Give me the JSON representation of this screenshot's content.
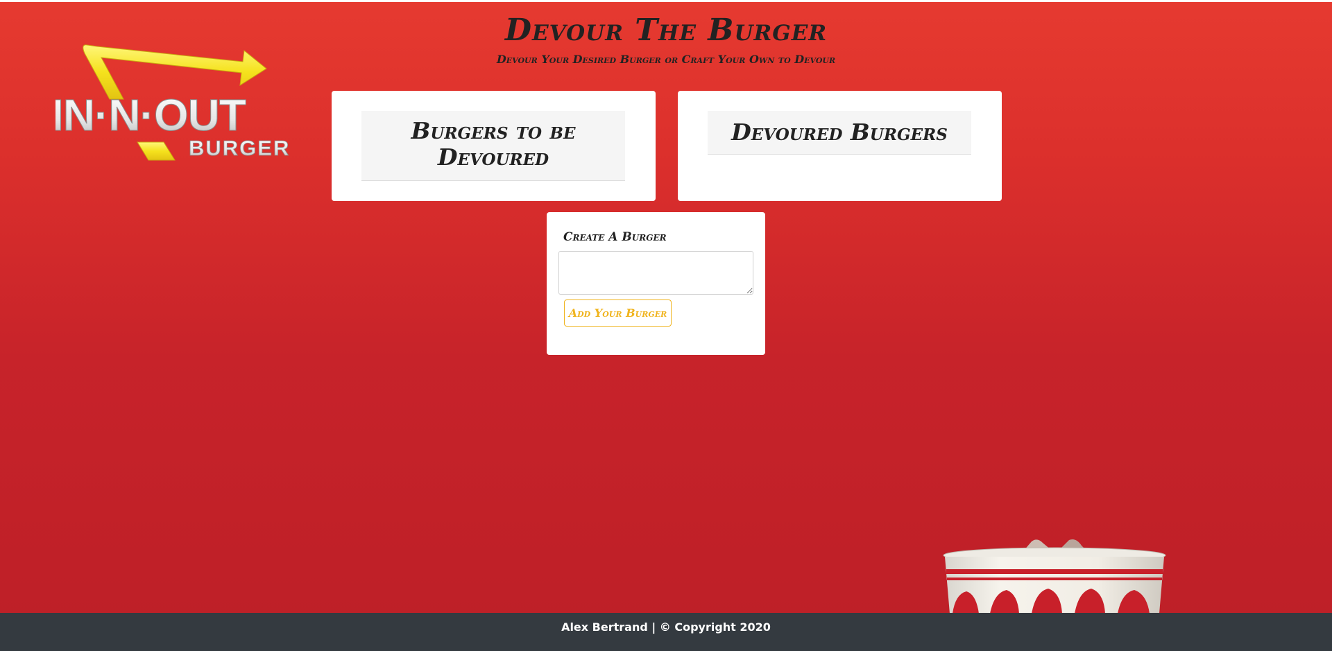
{
  "header": {
    "title": "Devour The Burger",
    "subtitle": "Devour Your Desired Burger or Craft Your Own to Devour"
  },
  "logo": {
    "line1": "IN·N·OUT",
    "line2": "BURGER"
  },
  "cards": {
    "to_devour": {
      "title_line1": "Burgers to be",
      "title_line2": "Devoured"
    },
    "devoured": {
      "title": "Devoured Burgers"
    }
  },
  "create_form": {
    "label": "Create A Burger",
    "input_value": "",
    "button_label": "Add Your Burger"
  },
  "footer": {
    "text": "Alex Bertrand | © Copyright 2020"
  },
  "colors": {
    "background_red": "#d42a2b",
    "footer": "#343a40",
    "button_accent": "#f0b41e",
    "logo_arrow": "#f5e21d"
  }
}
